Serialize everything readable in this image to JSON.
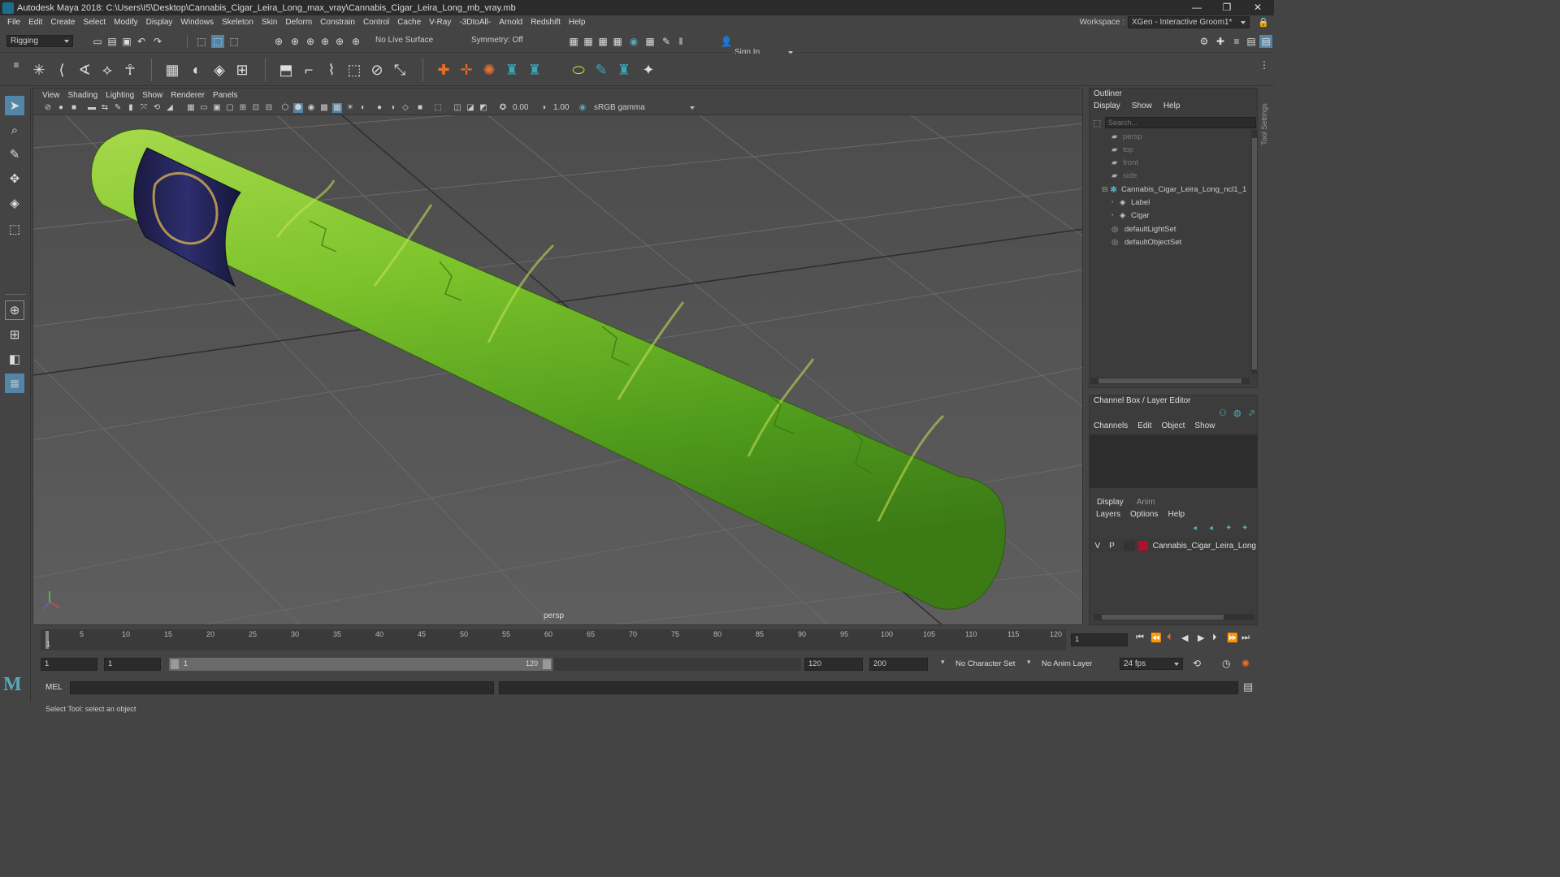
{
  "window": {
    "title": "Autodesk Maya 2018: C:\\Users\\I5\\Desktop\\Cannabis_Cigar_Leira_Long_max_vray\\Cannabis_Cigar_Leira_Long_mb_vray.mb",
    "minimize": "—",
    "restore": "❐",
    "close": "✕"
  },
  "menubar": {
    "items": [
      "File",
      "Edit",
      "Create",
      "Select",
      "Modify",
      "Display",
      "Windows",
      "Skeleton",
      "Skin",
      "Deform",
      "Constrain",
      "Control",
      "Cache",
      "V-Ray",
      "-3DtoAll-",
      "Arnold",
      "Redshift",
      "Help"
    ],
    "workspace_label": "Workspace :",
    "workspace_value": "XGen - Interactive Groom1*"
  },
  "statusline": {
    "menuset": "Rigging",
    "live_surface": "No Live Surface",
    "symmetry": "Symmetry: Off",
    "sign_in": "Sign In"
  },
  "viewport": {
    "menus": [
      "View",
      "Shading",
      "Lighting",
      "Show",
      "Renderer",
      "Panels"
    ],
    "exposure": "0.00",
    "gamma": "1.00",
    "color_space": "sRGB gamma",
    "camera": "persp"
  },
  "outliner": {
    "title": "Outliner",
    "menus": [
      "Display",
      "Show",
      "Help"
    ],
    "search_placeholder": "Search...",
    "items": [
      {
        "label": "persp",
        "kind": "camera",
        "dim": true
      },
      {
        "label": "top",
        "kind": "camera",
        "dim": true
      },
      {
        "label": "front",
        "kind": "camera",
        "dim": true
      },
      {
        "label": "side",
        "kind": "camera",
        "dim": true
      },
      {
        "label": "Cannabis_Cigar_Leira_Long_ncl1_1",
        "kind": "group",
        "dim": false
      },
      {
        "label": "Label",
        "kind": "mesh",
        "dim": false
      },
      {
        "label": "Cigar",
        "kind": "mesh",
        "dim": false
      },
      {
        "label": "defaultLightSet",
        "kind": "set",
        "dim": false
      },
      {
        "label": "defaultObjectSet",
        "kind": "set",
        "dim": false
      }
    ]
  },
  "channelbox": {
    "title": "Channel Box / Layer Editor",
    "menus": [
      "Channels",
      "Edit",
      "Object",
      "Show"
    ]
  },
  "layers": {
    "tabs": [
      "Display",
      "Anim"
    ],
    "menus": [
      "Layers",
      "Options",
      "Help"
    ],
    "row": {
      "v": "V",
      "p": "P",
      "name": "Cannabis_Cigar_Leira_Long",
      "color": "#b0102a"
    }
  },
  "timeline": {
    "ticks": [
      "1",
      "5",
      "10",
      "15",
      "20",
      "25",
      "30",
      "35",
      "40",
      "45",
      "50",
      "55",
      "60",
      "65",
      "70",
      "75",
      "80",
      "85",
      "90",
      "95",
      "100",
      "105",
      "110",
      "115",
      "120"
    ],
    "current_frame": "1"
  },
  "range": {
    "start": "1",
    "playback_start": "1",
    "slider_start": "1",
    "slider_end": "120",
    "playback_end": "120",
    "end": "200",
    "character_set": "No Character Set",
    "anim_layer": "No Anim Layer",
    "fps": "24 fps"
  },
  "cmdline": {
    "label": "MEL"
  },
  "helpline": {
    "text": "Select Tool: select an object"
  },
  "side_tab": "Tool Settings",
  "colors": {
    "accent": "#5285a6",
    "layer": "#b0102a",
    "cigar": "#7dc22f"
  }
}
